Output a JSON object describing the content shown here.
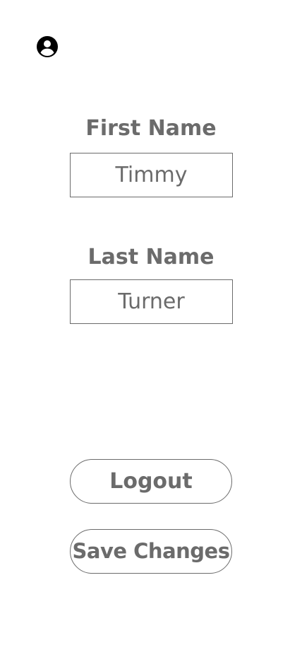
{
  "header": {
    "account_icon": "account-circle-icon"
  },
  "form": {
    "first_name_label": "First Name",
    "first_name_value": "Timmy",
    "last_name_label": "Last Name",
    "last_name_value": "Turner"
  },
  "actions": {
    "logout_label": "Logout",
    "save_label": "Save Changes"
  },
  "colors": {
    "text": "#6b6b6b",
    "border": "#6b6b6b",
    "icon": "#000000",
    "background": "#ffffff"
  }
}
